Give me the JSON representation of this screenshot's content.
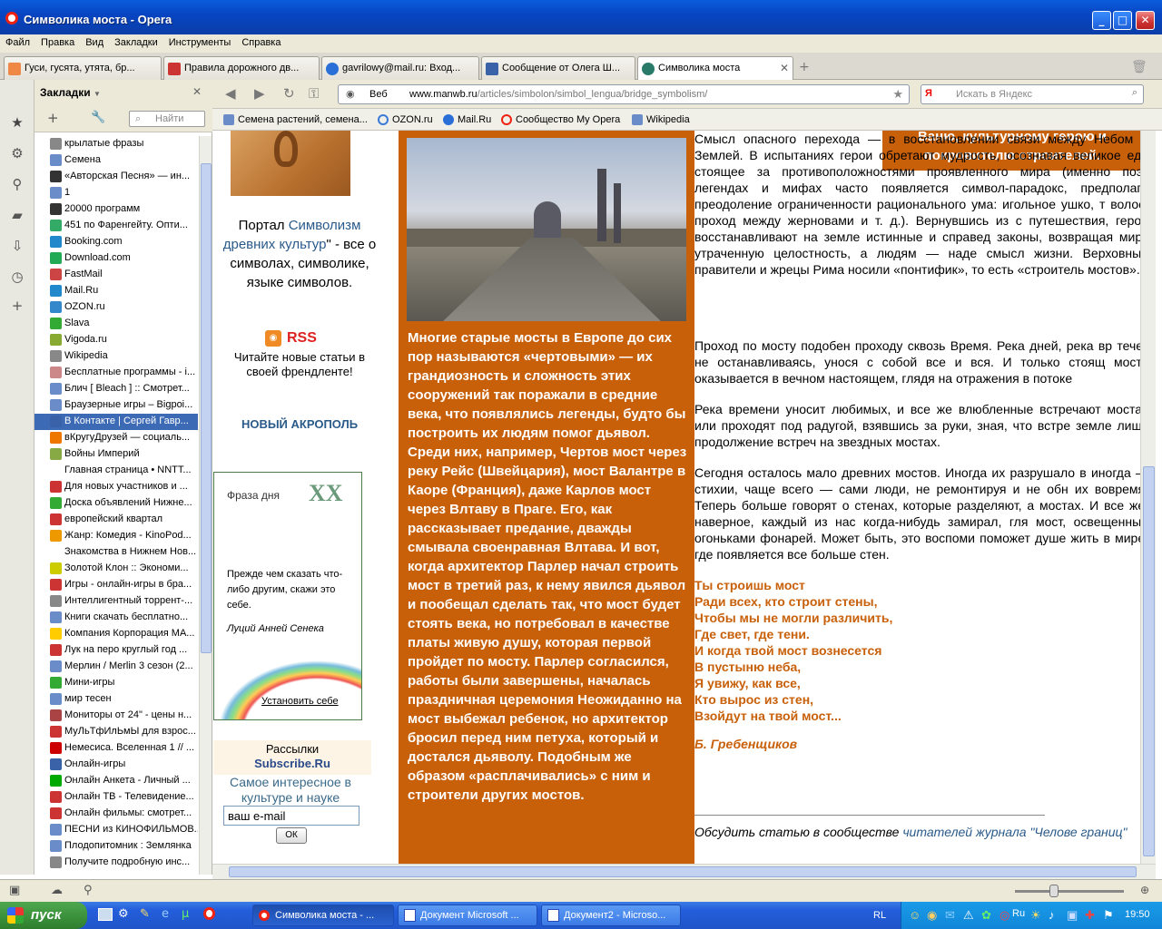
{
  "window": {
    "title": "Символика моста - Opera"
  },
  "menu": [
    "Файл",
    "Правка",
    "Вид",
    "Закладки",
    "Инструменты",
    "Справка"
  ],
  "tabs": [
    {
      "label": "Гуси, гусята, утята, бр...",
      "color": "#e84"
    },
    {
      "label": "Правила дорожного дв...",
      "color": "#c33"
    },
    {
      "label": "gavrilowy@mail.ru: Вход...",
      "color": "#2a6fd8"
    },
    {
      "label": "Сообщение от Олега Ш...",
      "color": "#3a62a8"
    },
    {
      "label": "Символика моста",
      "color": "#2a7a6a"
    }
  ],
  "bookmarks_panel": {
    "title": "Закладки",
    "search_placeholder": "Найти",
    "items": [
      "крылатые фразы",
      "Семена",
      "«Авторская Песня» — ин...",
      "1",
      "20000 программ",
      "451 по Фаренгейту. Опти...",
      "Booking.com",
      "Download.com",
      "FastMail",
      "Mail.Ru",
      "OZON.ru",
      "Slava",
      "Vigoda.ru",
      "Wikipedia",
      "Бесплатные программы - i...",
      "Блич [ Bleach ] :: Смотрет...",
      "Браузерные игры – Bigpoi...",
      "В Контакте | Сергей Гавр...",
      "вКругуДрузей — социаль...",
      "Войны Империй",
      "Главная страница • NNTT...",
      "Для новых участников и ...",
      "Доска объявлений Нижне...",
      "европейский квартал",
      "Жанр: Комедия - KinoPod...",
      "Знакомства в Нижнем Нов...",
      "Золотой Клон :: Экономи...",
      "Игры - онлайн-игры в бра...",
      "Интеллигентный торрент-...",
      "Книги скачать бесплатно...",
      "Компания Корпорация МА...",
      "Лук на перо круглый год ...",
      "Мерлин / Merlin 3 сезон (2...",
      "Мини-игры",
      "мир тесен",
      "Мониторы от 24\" - цены н...",
      "МуЛьТфИлЬмЫ для взрос...",
      "Немесиса. Вселенная 1 // ...",
      "Онлайн-игры",
      "Онлайн Анкета - Личный ...",
      "Онлайн ТВ - Телевидение...",
      "Онлайн фильмы: смотрет...",
      "ПЕСНИ из КИНОФИЛЬМОВ...",
      "Плодопитомник : Землянка",
      "Получите подробную инс..."
    ]
  },
  "address": {
    "label": "Веб",
    "url_host": "www.manwb.ru",
    "url_path": "/articles/simbolon/simbol_lengua/bridge_symbolism/",
    "search_placeholder": "Искать в Яндекс"
  },
  "personal_bar": [
    "Семена растений, семена...",
    "OZON.ru",
    "Mail.Ru",
    "Сообщество My Opera",
    "Wikipedia"
  ],
  "page": {
    "portal_prefix": "Портал ",
    "portal_link": "Символизм древних культур",
    "portal_suffix": "\" - все о символах, символике, языке символов.",
    "rss": "RSS",
    "rss_desc": "Читайте новые статьи в своей френдленте!",
    "akropol": "НОВЫЙ АКРОПОЛЬ",
    "phrase_title": "Фраза дня",
    "phrase_text": "Прежде чем сказать что-либо другим, скажи это себе.",
    "phrase_author": "Луций Анней Сенека",
    "phrase_install": "Установить себе",
    "subs_title": "Рассылки",
    "subs_brand": "Subscribe.Ru",
    "subs_desc": "Самое интересное в культуре и науке",
    "subs_input": "ваш e-mail",
    "subs_ok": "ОК",
    "orange_top": "Ваню, культурному герою и покровителю строителей.",
    "orange_text": "Многие старые мосты в Европе до сих пор называются «чертовыми» — их грандиозность и сложность этих сооружений так поражали в средние века, что появлялись легенды, будто бы построить их людям помог дьявол. Среди них, например, Чертов мост через реку Рейс (Швейцария), мост Валантре в Каоре (Франция), даже Карлов мост через Влтаву в Праге. Его, как рассказывает предание, дважды смывала своенравная Влтава. И вот, когда архитектор Парлер начал строить мост в третий раз, к нему явился дьявол и пообещал сделать так, что мост будет стоять века, но потребовал в качестве платы живую душу, которая первой пройдет по мосту. Парлер согласился, работы были завершены, началась праздничная церемония Неожиданно на мост выбежал ребенок, но архитектор бросил перед ним петуха, который и достался дьяволу. Подобным же образом «расплачивались» с ним и строители других мостов.",
    "para1": "Смысл опасного перехода — в восстановлении связи между Небом и Землей. В испытаниях герои обретают мудрость, осознавая великое еди стоящее за противоположностями проявленного мира (именно поэт легендах и мифах часто появляется символ-парадокс, предполага преодоление ограниченности рационального ума: игольное ушко, т волос, проход между жерновами и т. д.). Вернувшись из с путешествия, герои восстанавливают на земле истинные и справед законы, возвращая миру утраченную целостность, а людям — наде смысл жизни. Верховные правители и жрецы Рима носили «понтифик», то есть «строитель мостов».",
    "para2": "Проход по мосту подобен проходу сквозь Время. Река дней, река вр течет не останавливаясь, унося с собой все и вся. И только стоящ мосту оказывается в вечном настоящем, глядя на отражения в потоке",
    "para3": "Река времени уносит любимых, и все же влюбленные встречают мостах или проходят под радугой, взявшись за руки, зная, что встре земле лишь продолжение встреч на звездных мостах.",
    "para4": "Сегодня осталось мало древних мостов. Иногда их разрушало в иногда — стихии, чаще всего — сами люди, не ремонтируя и не обн их вовремя. Теперь больше говорят о стенах, которые разделяют, а мостах. И все же, наверное, каждый из нас когда-нибудь замирал, гля мост, освещенный огоньками фонарей. Может быть, это воспоми поможет душе жить в мире, где появляется все больше стен.",
    "poem": [
      "Ты строишь мост",
      "Ради всех, кто строит стены,",
      "Чтобы мы не могли различить,",
      "Где свет, где тени.",
      "И когда твой мост вознесется",
      "В пустыню неба,",
      "Я увижу, как все,",
      "Кто вырос из стен,",
      "Взойдут на твой мост..."
    ],
    "poem_author": "Б. Гребенщиков",
    "discuss_prefix": "Обсудить статью в сообществе ",
    "discuss_link": "читателей журнала \"Челове границ\""
  },
  "taskbar": {
    "start": "пуск",
    "items": [
      "Символика моста - ...",
      "Документ Microsoft ...",
      "Документ2 - Microso..."
    ],
    "lang": "RL",
    "clock": "19:50"
  }
}
